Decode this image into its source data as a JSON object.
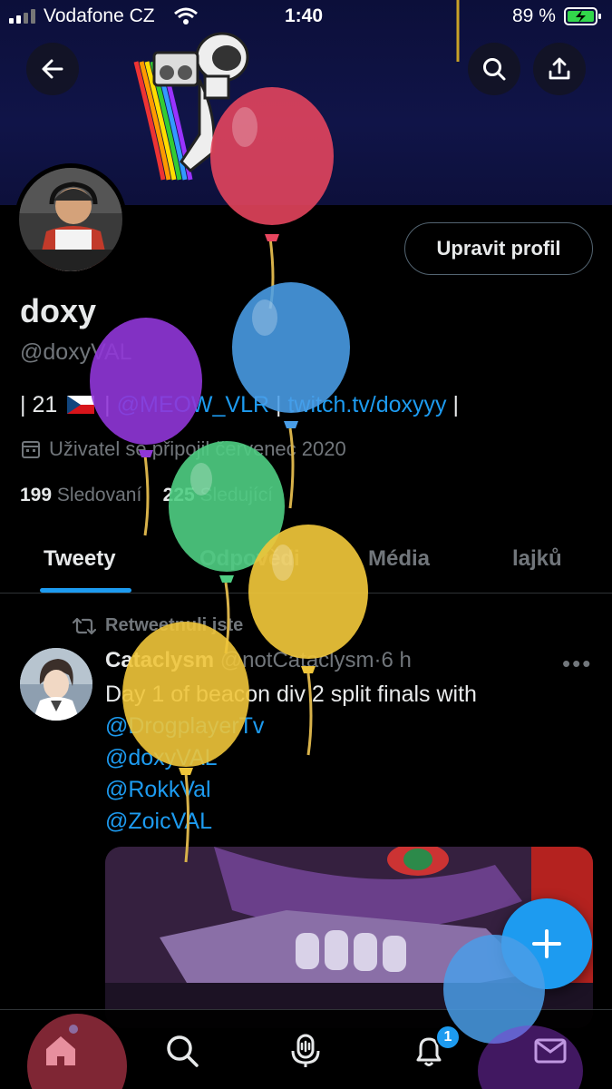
{
  "status_bar": {
    "carrier": "Vodafone CZ",
    "time": "1:40",
    "battery": "89 %"
  },
  "profile": {
    "edit_button": "Upravit profil",
    "display_name": "doxy",
    "handle": "@doxyVAL",
    "bio": {
      "prefix": "| 21",
      "sep1": " | ",
      "team_link": "@MEOW_VLR",
      "sep2": " | ",
      "twitch_link": "twitch.tv/doxyyy",
      "suffix": " |"
    },
    "joined": "Uživatel se připojil červenec 2020",
    "following_count": "199",
    "following_label": "Sledovaní",
    "followers_count": "225",
    "followers_label": "Sledující"
  },
  "tabs": [
    {
      "label": "Tweety",
      "active": true
    },
    {
      "label": "Odpovědi",
      "active": false
    },
    {
      "label": "Média",
      "active": false
    },
    {
      "label": "lajků",
      "active": false
    }
  ],
  "tweet": {
    "retweet_label": "Retweetnuli jste",
    "author_name": "Cataclysm",
    "author_handle": "@notCataclysm",
    "time": "6 h",
    "more": "•••",
    "text": "Day 1 of beacon div 2 split finals with",
    "mentions": [
      "@DrogplayerTv",
      "@doxyVAL",
      "@RokkVal",
      "@ZoicVAL"
    ]
  },
  "bottom_nav": {
    "notification_badge": "1"
  },
  "icons": {
    "back": "arrow-left-icon",
    "search": "search-icon",
    "share": "share-icon",
    "calendar": "calendar-icon",
    "retweet": "retweet-icon",
    "compose": "plus-icon",
    "home": "home-icon",
    "explore": "search-icon",
    "spaces": "microphone-icon",
    "notifications": "bell-icon",
    "messages": "envelope-icon"
  },
  "colors": {
    "accent": "#1d9bf0",
    "background": "#000000",
    "secondary_text": "#71767b"
  }
}
